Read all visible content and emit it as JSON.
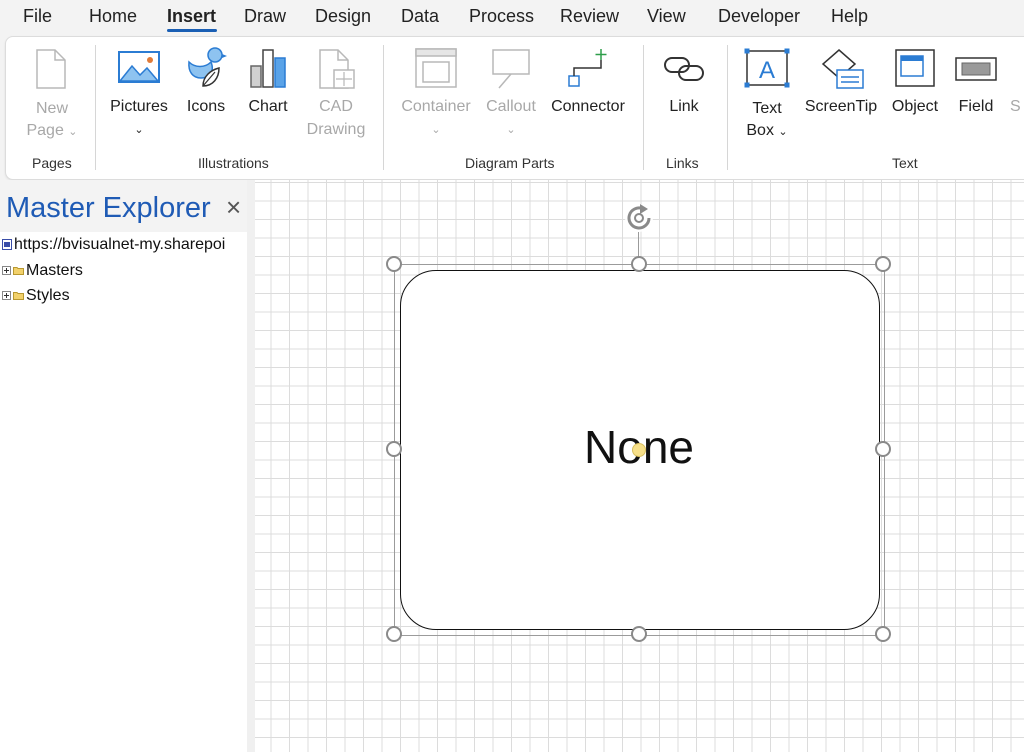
{
  "menu": {
    "items": [
      "File",
      "Home",
      "Insert",
      "Draw",
      "Design",
      "Data",
      "Process",
      "Review",
      "View",
      "Developer",
      "Help"
    ],
    "active": "Insert"
  },
  "ribbon": {
    "groups": {
      "pages": "Pages",
      "illustrations": "Illustrations",
      "diagram_parts": "Diagram Parts",
      "links": "Links",
      "text": "Text"
    },
    "buttons": {
      "new_page_1": "New",
      "new_page_2": "Page",
      "pictures": "Pictures",
      "icons": "Icons",
      "chart": "Chart",
      "cad_1": "CAD",
      "cad_2": "Drawing",
      "container": "Container",
      "callout": "Callout",
      "connector": "Connector",
      "link": "Link",
      "textbox_1": "Text",
      "textbox_2": "Box",
      "screentip": "ScreenTip",
      "object": "Object",
      "field": "Field",
      "symbol_partial": "S"
    },
    "accent_color": "#1a5fb4",
    "icon_blue": "#2b7cd3"
  },
  "explorer": {
    "title": "Master Explorer",
    "close": "×",
    "tree": {
      "root": "https://bvisualnet-my.sharepoi",
      "masters": "Masters",
      "styles": "Styles"
    },
    "title_color": "#1f5bb5"
  },
  "canvas": {
    "shape_text": "None"
  }
}
